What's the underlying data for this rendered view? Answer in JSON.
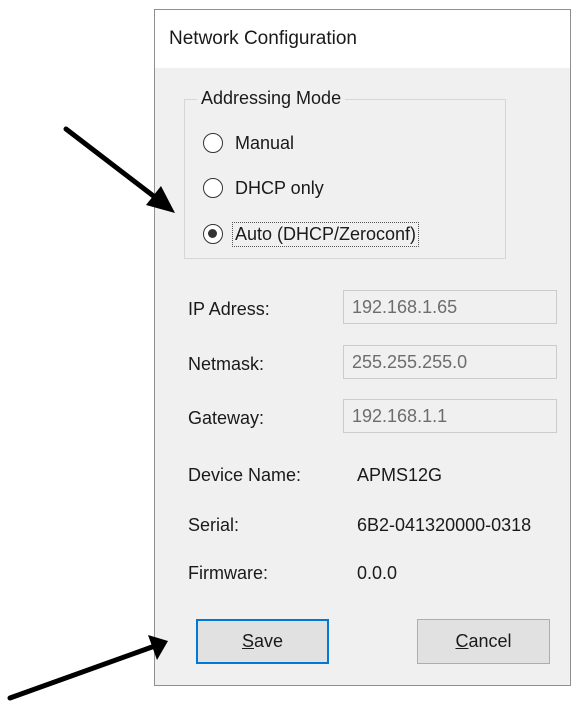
{
  "dialog": {
    "title": "Network Configuration"
  },
  "addressing": {
    "label": "Addressing Mode",
    "options": [
      {
        "label": "Manual",
        "checked": false
      },
      {
        "label": "DHCP only",
        "checked": false
      },
      {
        "label": "Auto (DHCP/Zeroconf)",
        "checked": true
      }
    ]
  },
  "fields": {
    "ip": {
      "label": "IP Adress:",
      "value": "192.168.1.65"
    },
    "netmask": {
      "label": "Netmask:",
      "value": "255.255.255.0"
    },
    "gateway": {
      "label": "Gateway:",
      "value": "192.168.1.1"
    }
  },
  "info": {
    "device_name": {
      "label": "Device Name:",
      "value": "APMS12G"
    },
    "serial": {
      "label": "Serial:",
      "value": "6B2-041320000-0318"
    },
    "firmware": {
      "label": "Firmware:",
      "value": "0.0.0"
    }
  },
  "buttons": {
    "save": {
      "mnemonic": "S",
      "rest": "ave"
    },
    "cancel": {
      "mnemonic": "C",
      "rest": "ancel"
    }
  },
  "colors": {
    "accent": "#0078d7",
    "dialog_bg": "#f0f0f0",
    "annotation_arrow": "#000000"
  }
}
